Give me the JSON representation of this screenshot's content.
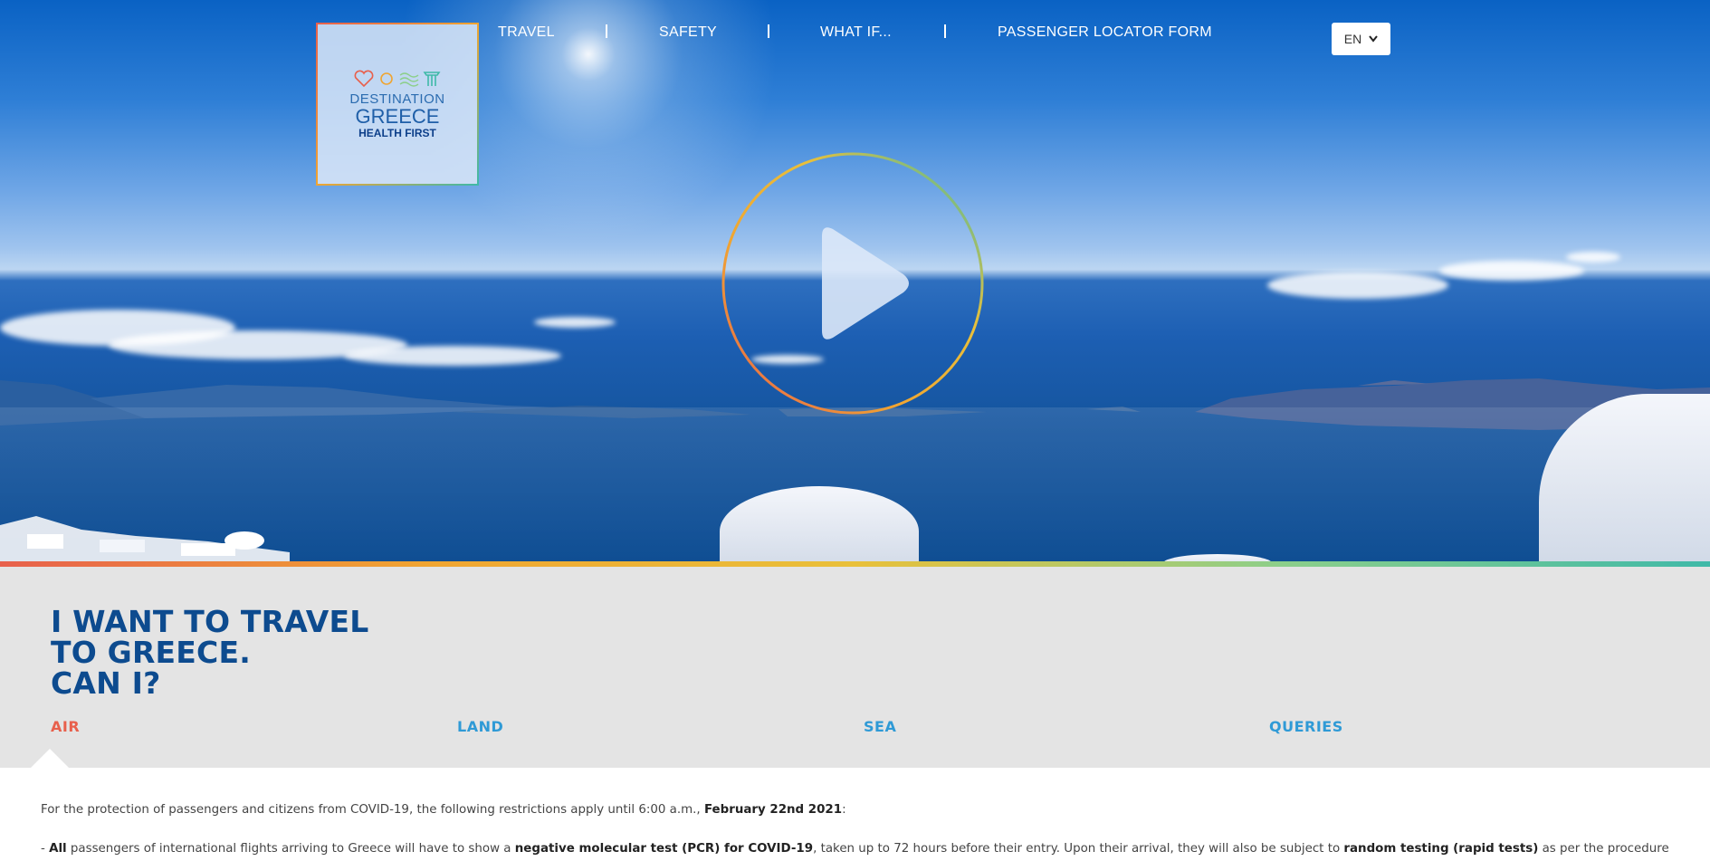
{
  "logo": {
    "line1": "DESTINATION",
    "line2": "GREECE",
    "line3": "HEALTH FIRST"
  },
  "nav": {
    "items": [
      "TRAVEL",
      "SAFETY",
      "WHAT IF...",
      "PASSENGER LOCATOR FORM"
    ],
    "language": "EN"
  },
  "hero": {
    "video_control": "play-icon"
  },
  "question": {
    "title_lines": [
      "I WANT TO TRAVEL",
      "TO GREECE.",
      "CAN I?"
    ],
    "tabs": [
      "AIR",
      "LAND",
      "SEA",
      "QUERIES"
    ],
    "active_tab": "AIR"
  },
  "content": {
    "p1": {
      "text": "For the protection of passengers and citizens from COVID-19, the following restrictions apply until 6:00 a.m.,",
      "bold": "February 22nd 2021",
      "end": ":"
    },
    "p2": {
      "t0": "- ",
      "b0": "All",
      "t1": " passengers of international flights arriving to Greece will have to show a ",
      "b1": "negative molecular test (PCR) for COVID-19",
      "t2": ", taken up to 72 hours before their entry. Upon their arrival, they will also be subject to ",
      "b2": "random testing (rapid tests)",
      "t3": " as per the procedure"
    }
  },
  "colors": {
    "brand_blue": "#0d4b8f",
    "tab_blue": "#2f9ad6",
    "accent_orange": "#e8604c",
    "section_gray": "#e4e4e4"
  }
}
